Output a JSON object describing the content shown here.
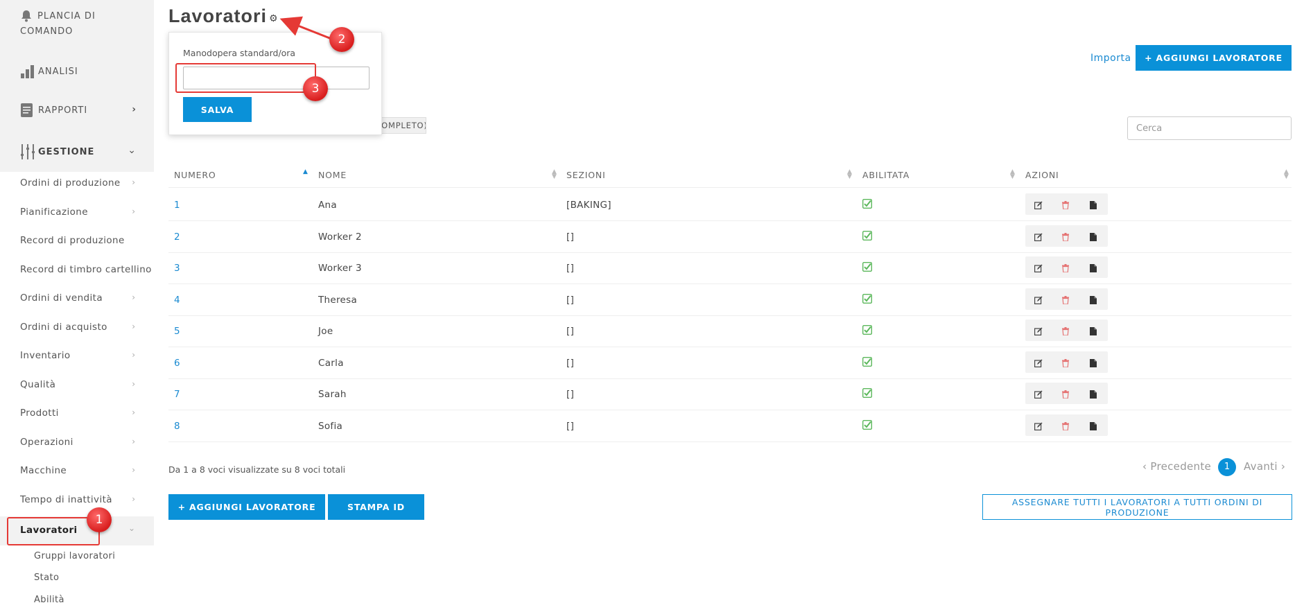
{
  "sidebar": {
    "top_items": [
      {
        "label": "PLANCIA DI COMANDO",
        "icon": "bell-icon"
      },
      {
        "label": "ANALISI",
        "icon": "bar-chart-icon"
      },
      {
        "label": "RAPPORTI",
        "icon": "document-icon"
      }
    ],
    "gestione_label": "GESTIONE",
    "items": [
      {
        "label": "Ordini di produzione"
      },
      {
        "label": "Pianificazione"
      },
      {
        "label": "Record di produzione"
      },
      {
        "label": "Record di timbro cartellino"
      },
      {
        "label": "Ordini di vendita"
      },
      {
        "label": "Ordini di acquisto"
      },
      {
        "label": "Inventario"
      },
      {
        "label": "Qualità"
      },
      {
        "label": "Prodotti"
      },
      {
        "label": "Operazioni"
      },
      {
        "label": "Macchine"
      },
      {
        "label": "Tempo di inattività"
      },
      {
        "label": "Lavoratori"
      }
    ],
    "sub_items": [
      {
        "label": "Gruppi lavoratori"
      },
      {
        "label": "Stato"
      },
      {
        "label": "Abilità"
      }
    ]
  },
  "page": {
    "title": "Lavoratori",
    "import_link": "Importa",
    "add_worker_top": "+ AGGIUNGI LAVORATORE",
    "filter_chip": "(COMPLETO)",
    "search_placeholder": "Cerca"
  },
  "popover": {
    "label": "Manodopera standard/ora",
    "input_value": "",
    "save": "SALVA"
  },
  "table": {
    "headers": [
      "NUMERO",
      "NOME",
      "SEZIONI",
      "ABILITATA",
      "AZIONI"
    ],
    "rows": [
      {
        "number": "1",
        "name": "Ana",
        "sections": "[BAKING]",
        "enabled": true
      },
      {
        "number": "2",
        "name": "Worker 2",
        "sections": "[]",
        "enabled": true
      },
      {
        "number": "3",
        "name": "Worker 3",
        "sections": "[]",
        "enabled": true
      },
      {
        "number": "4",
        "name": "Theresa",
        "sections": "[]",
        "enabled": true
      },
      {
        "number": "5",
        "name": "Joe",
        "sections": "[]",
        "enabled": true
      },
      {
        "number": "6",
        "name": "Carla",
        "sections": "[]",
        "enabled": true
      },
      {
        "number": "7",
        "name": "Sarah",
        "sections": "[]",
        "enabled": true
      },
      {
        "number": "8",
        "name": "Sofia",
        "sections": "[]",
        "enabled": true
      }
    ]
  },
  "pagination": {
    "info": "Da 1 a 8 voci visualizzate su 8 voci totali",
    "prev": "‹ Precedente",
    "current": "1",
    "next": "Avanti ›"
  },
  "bottom_buttons": {
    "add_worker": "+ AGGIUNGI LAVORATORE",
    "print_id": "STAMPA ID",
    "assign_all": "ASSEGNARE TUTTI I LAVORATORI A TUTTI ORDINI DI PRODUZIONE"
  },
  "annotations": [
    "1",
    "2",
    "3"
  ],
  "colors": {
    "accent": "#0a91d8",
    "link": "#1a8ad1",
    "check_green": "#5cb85c",
    "delete_red": "#e57373",
    "annotation_red": "#e53935"
  }
}
